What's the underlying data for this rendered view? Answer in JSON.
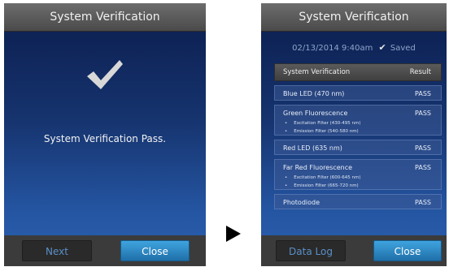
{
  "left": {
    "title": "System Verification",
    "message": "System Verification Pass.",
    "next_label": "Next",
    "close_label": "Close",
    "icon": "checkmark-icon"
  },
  "right": {
    "title": "System Verification",
    "timestamp": "02/13/2014 9:40am",
    "saved_label": "Saved",
    "table": {
      "header_name": "System Verification",
      "header_result": "Result",
      "rows": [
        {
          "name": "Blue LED (470 nm)",
          "result": "PASS"
        },
        {
          "name": "Green Fluorescence",
          "result": "PASS",
          "details": [
            "Excitation Filter (430-495 nm)",
            "Emission Filter (540-580 nm)"
          ]
        },
        {
          "name": "Red LED (635 nm)",
          "result": "PASS"
        },
        {
          "name": "Far Red Fluorescence",
          "result": "PASS",
          "details": [
            "Excitation Filter (600-645 nm)",
            "Emission Filter (665-720 nm)"
          ]
        },
        {
          "name": "Photodiode",
          "result": "PASS"
        }
      ]
    },
    "datalog_label": "Data Log",
    "close_label": "Close"
  },
  "colors": {
    "accent_blue": "#2f8fd0",
    "title_bar": "#5a5a5a",
    "background_top": "#0b1d4d",
    "background_bottom": "#2a5fae"
  }
}
